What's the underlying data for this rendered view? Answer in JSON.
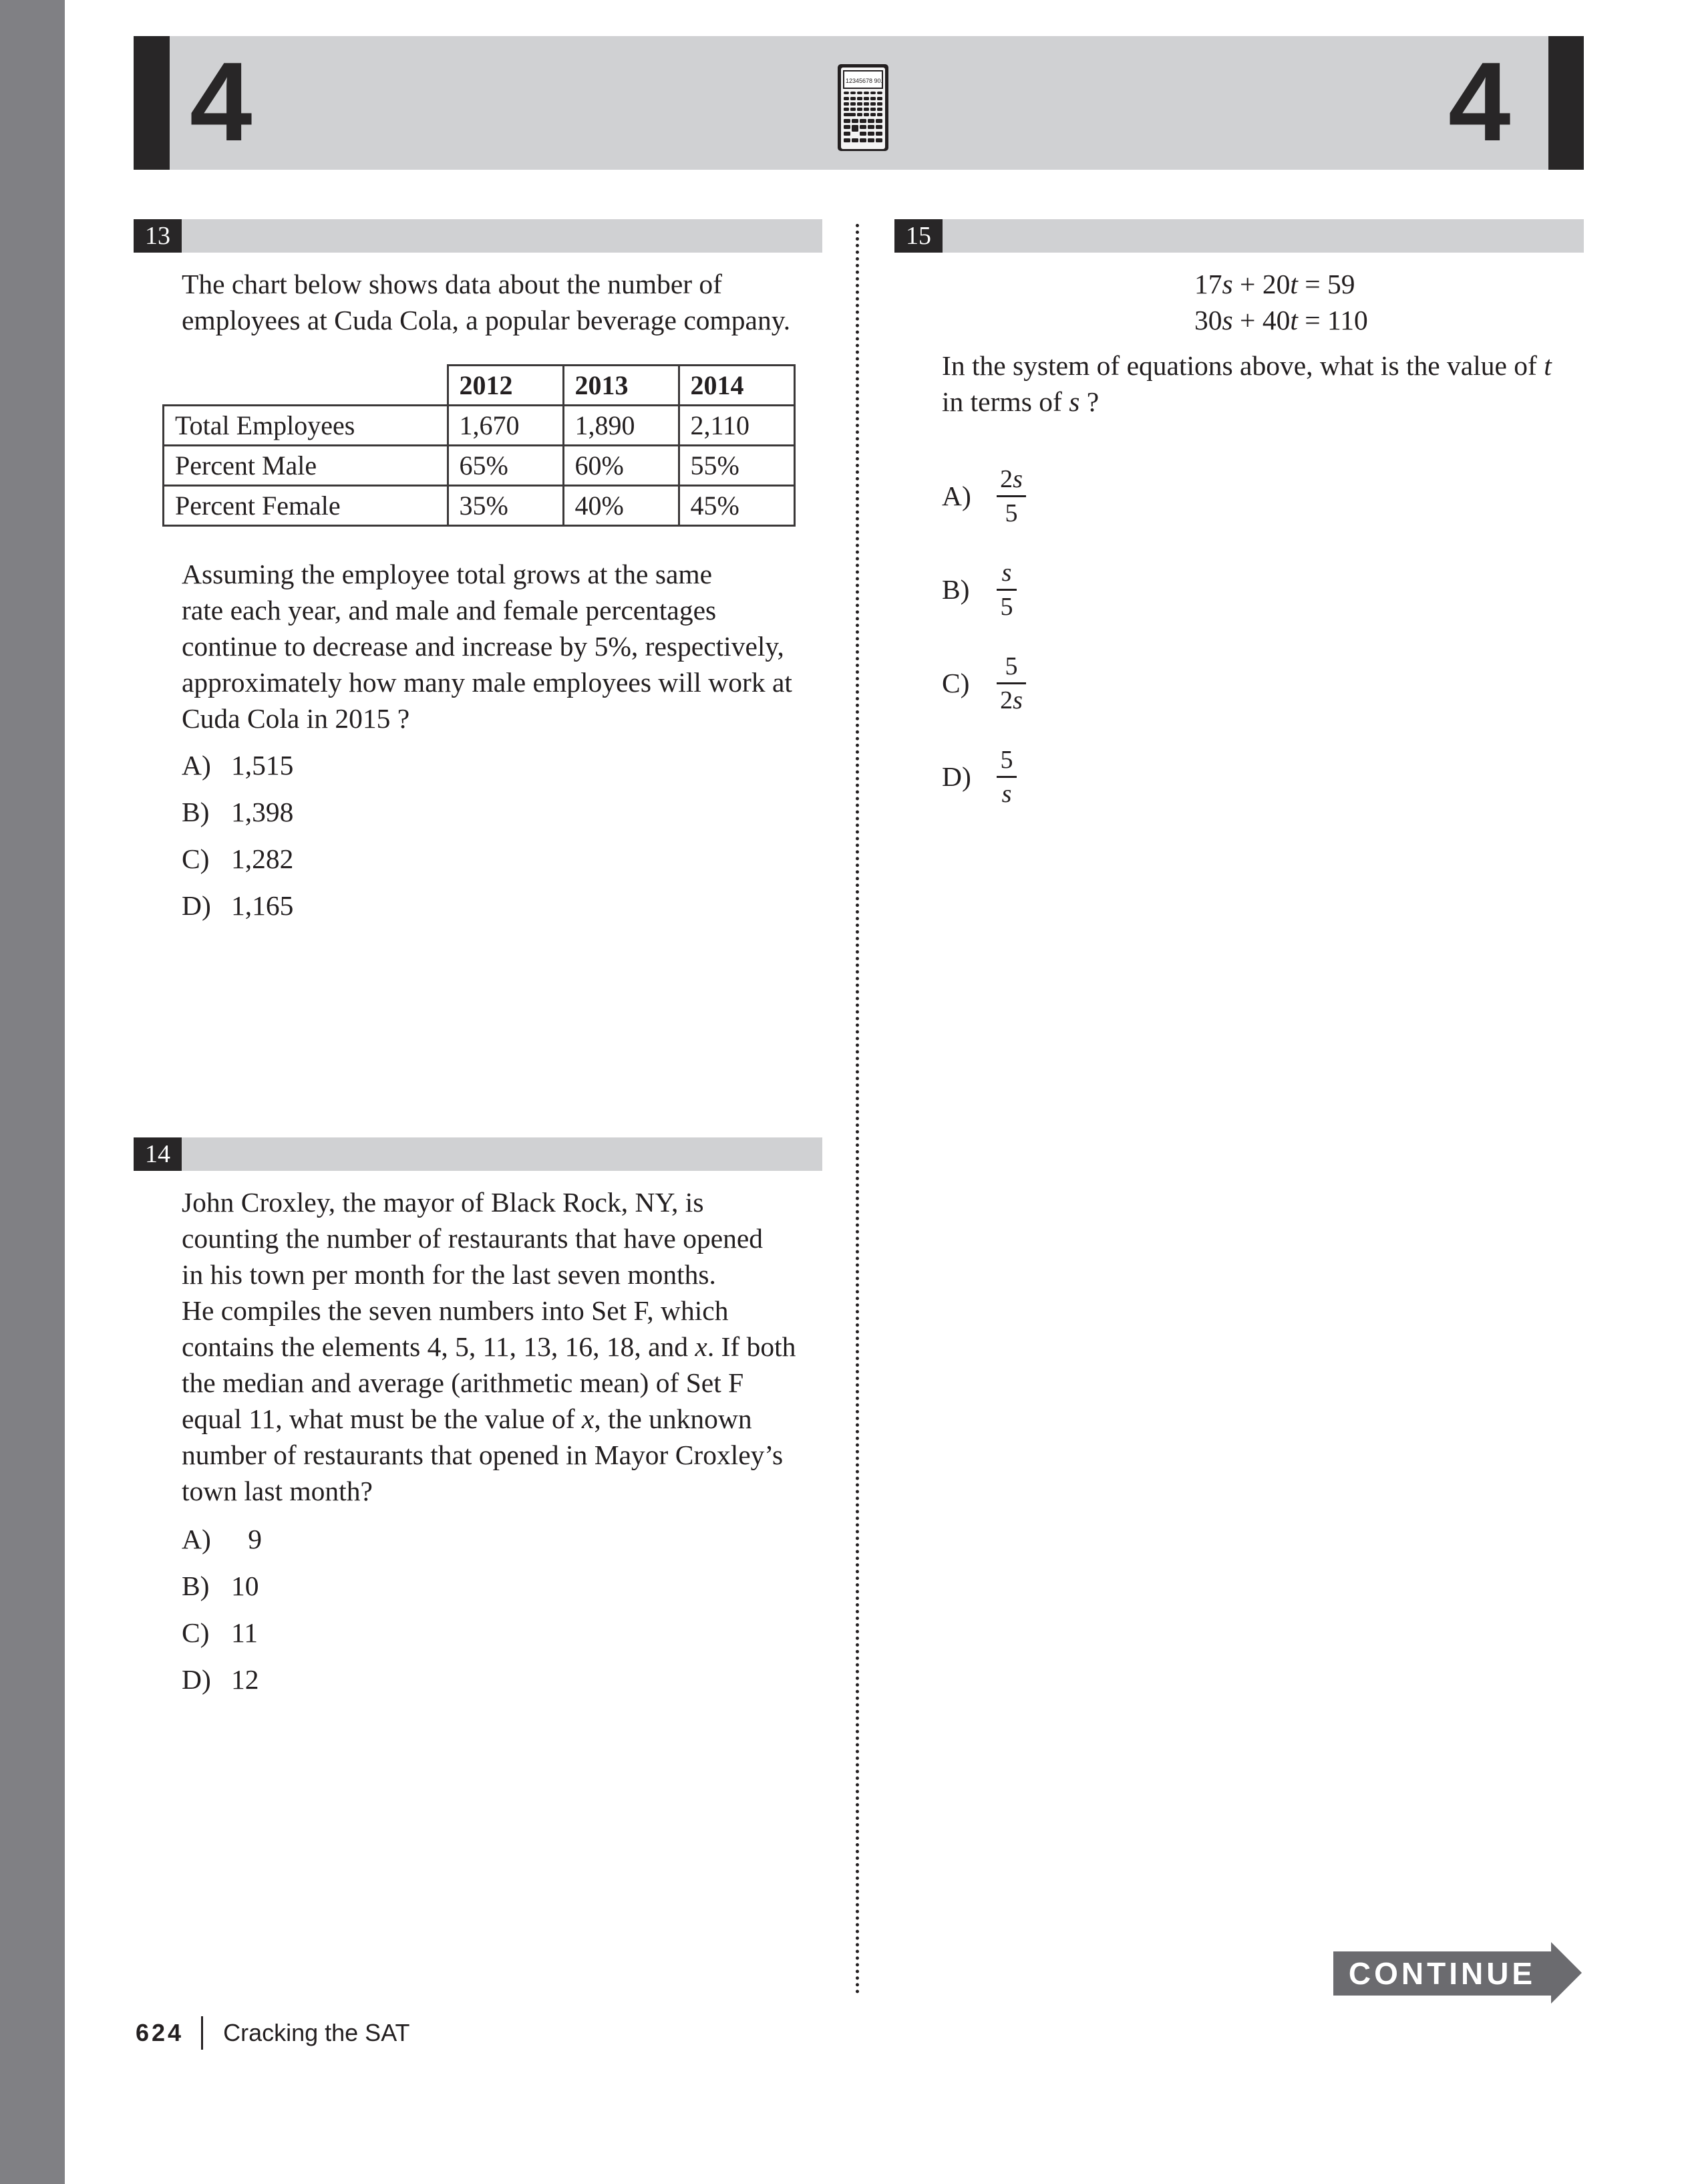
{
  "header": {
    "section_number_left": "4",
    "section_number_right": "4",
    "calculator_icon": "calculator-icon",
    "calculator_display": "12345678 90."
  },
  "questions": {
    "q13": {
      "number": "13",
      "intro": "The chart below shows data about the number of employees at Cuda Cola, a popular beverage company.",
      "intro_lines": [
        "The chart below shows data about the number of",
        "employees at Cuda Cola, a popular beverage company."
      ],
      "table": {
        "columns": [
          "",
          "2012",
          "2013",
          "2014"
        ],
        "rows": [
          {
            "label": "Total Employees",
            "values": [
              "1,670",
              "1,890",
              "2,110"
            ]
          },
          {
            "label": "Percent Male",
            "values": [
              "65%",
              "60%",
              "55%"
            ]
          },
          {
            "label": "Percent Female",
            "values": [
              "35%",
              "40%",
              "45%"
            ]
          }
        ]
      },
      "prompt_lines": [
        "Assuming the employee total grows at the same",
        "rate each year, and male and female percentages",
        "continue to decrease and increase by 5%, respectively,",
        "approximately how many male employees will work at",
        "Cuda Cola in 2015 ?"
      ],
      "options": [
        {
          "letter": "A)",
          "text": "1,515"
        },
        {
          "letter": "B)",
          "text": "1,398"
        },
        {
          "letter": "C)",
          "text": "1,282"
        },
        {
          "letter": "D)",
          "text": "1,165"
        }
      ]
    },
    "q14": {
      "number": "14",
      "prompt_lines": [
        "John Croxley, the mayor of Black Rock, NY, is",
        "counting the number of restaurants that have opened",
        "in his town per month for the last seven months.",
        "He compiles the seven numbers into Set F, which",
        "contains the elements 4, 5, 11, 13, 16, 18, and x. If both",
        "the median and average (arithmetic mean) of Set F",
        "equal 11, what must be the value of x, the unknown",
        "number of restaurants that opened in Mayor Croxley’s",
        "town last month?"
      ],
      "options": [
        {
          "letter": "A)",
          "text": "9"
        },
        {
          "letter": "B)",
          "text": "10"
        },
        {
          "letter": "C)",
          "text": "11"
        },
        {
          "letter": "D)",
          "text": "12"
        }
      ]
    },
    "q15": {
      "number": "15",
      "equations": [
        {
          "a": "17",
          "b": "20",
          "rhs": "59"
        },
        {
          "a": "30",
          "b": "40",
          "rhs": "110"
        }
      ],
      "prompt_lines": [
        "In the system of equations above, what is the value of t",
        "in terms of s ?"
      ],
      "options": [
        {
          "letter": "A)",
          "numerator": "2s",
          "denominator": "5"
        },
        {
          "letter": "B)",
          "numerator": "s",
          "denominator": "5"
        },
        {
          "letter": "C)",
          "numerator": "5",
          "denominator": "2s"
        },
        {
          "letter": "D)",
          "numerator": "5",
          "denominator": "s"
        }
      ]
    }
  },
  "continue_button": {
    "label": "CONTINUE"
  },
  "footer": {
    "page_number": "624",
    "book_title": "Cracking the SAT"
  },
  "colors": {
    "header_gray": "#d0d1d3",
    "badge_black": "#282627",
    "side_stripe": "#808084",
    "continue_gray": "#6b6b6f"
  }
}
